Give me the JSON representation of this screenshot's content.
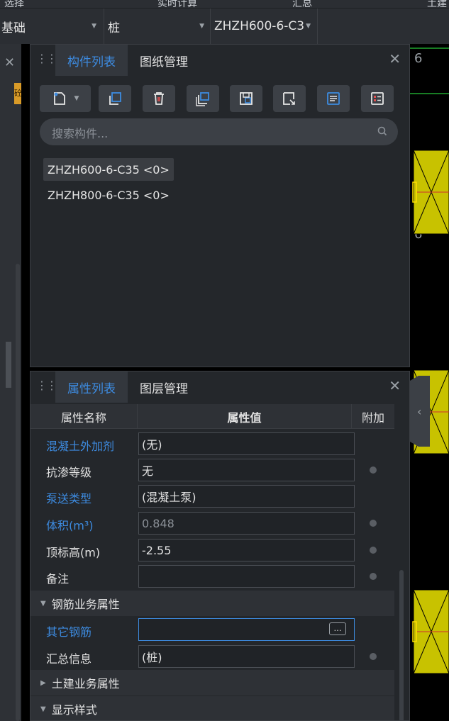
{
  "top_tabs": [
    "选择",
    "实时计算",
    "汇总",
    "土建"
  ],
  "dropdowns": {
    "category": "基础",
    "type": "桩",
    "component": "ZHZH600-6-C3"
  },
  "component_panel": {
    "tabs": [
      "构件列表",
      "图纸管理"
    ],
    "active_tab": 0,
    "close_icon": "close-icon",
    "toolbar": [
      "new-component-icon",
      "copy-icon",
      "delete-icon",
      "copy-to-floor-icon",
      "import-icon",
      "export-icon",
      "list-view-icon",
      "settings-icon"
    ],
    "search_placeholder": "搜索构件...",
    "items": [
      {
        "label": "ZHZH600-6-C35 <0>",
        "selected": true
      },
      {
        "label": "ZHZH800-6-C35 <0>",
        "selected": false
      }
    ]
  },
  "property_panel": {
    "tabs": [
      "属性列表",
      "图层管理"
    ],
    "active_tab": 0,
    "headers": {
      "name": "属性名称",
      "value": "属性值",
      "extra": "附加"
    },
    "rows": [
      {
        "name": "混凝土外加剂",
        "value": "(无)",
        "blue": true,
        "dot": false,
        "dim": false
      },
      {
        "name": "抗渗等级",
        "value": "无",
        "blue": false,
        "dot": true,
        "dim": false
      },
      {
        "name": "泵送类型",
        "value": "(混凝土泵)",
        "blue": true,
        "dot": false,
        "dim": false
      },
      {
        "name": "体积(m³)",
        "value": "0.848",
        "blue": true,
        "dot": true,
        "dim": true
      },
      {
        "name": "顶标高(m)",
        "value": "-2.55",
        "blue": false,
        "dot": true,
        "dim": false
      },
      {
        "name": "备注",
        "value": "",
        "blue": false,
        "dot": true,
        "dim": false
      }
    ],
    "section_rebar": "钢筋业务属性",
    "rebar_rows": [
      {
        "name": "其它钢筋",
        "value": "",
        "blue": true,
        "dot": false,
        "button": "…"
      },
      {
        "name": "汇总信息",
        "value": "(桩)",
        "blue": false,
        "dot": true
      }
    ],
    "section_civil": "土建业务属性",
    "section_display": "显示样式"
  },
  "left_strip_badge": "砼",
  "canvas": {
    "label_6": "6"
  },
  "colors": {
    "accent": "#3d8be0",
    "panel_bg": "#24272b",
    "canvas_bg": "#000000",
    "pile_fill": "#c8c200"
  }
}
